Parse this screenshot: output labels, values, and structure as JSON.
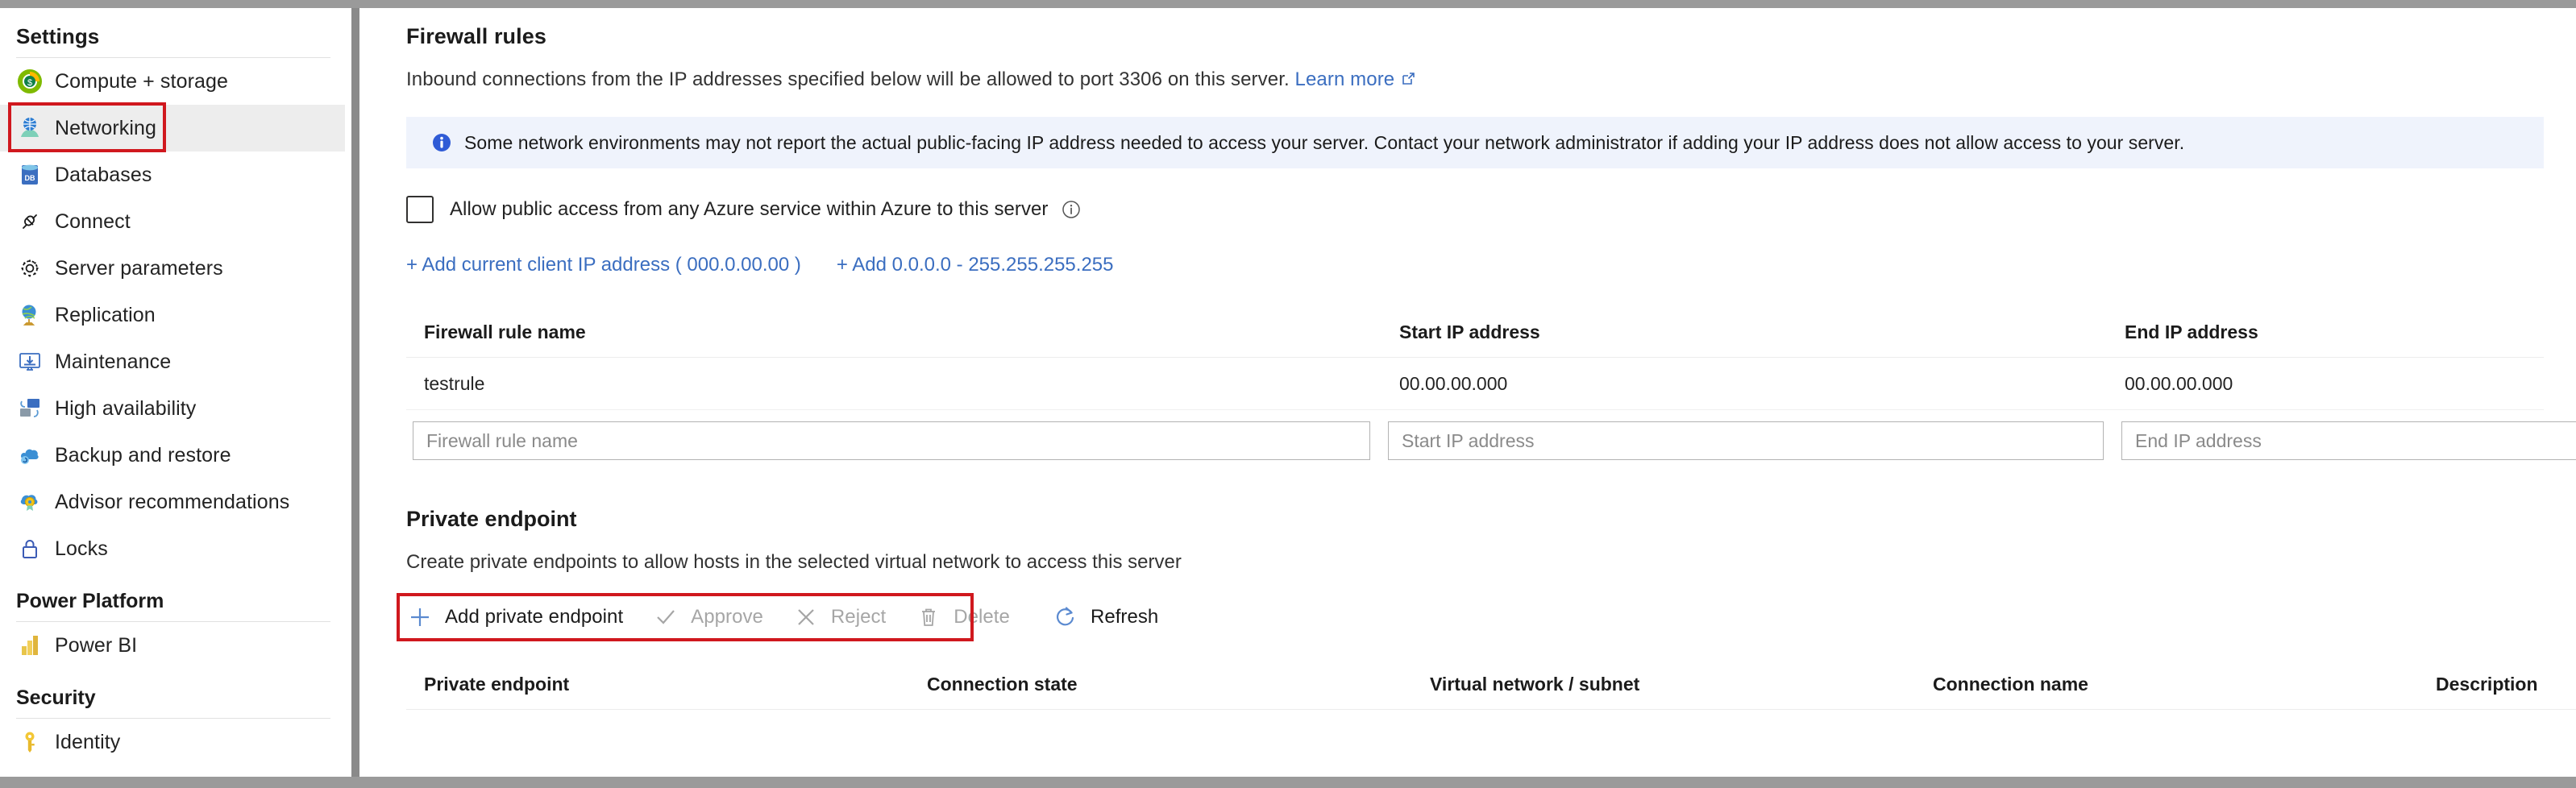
{
  "sidebar": {
    "heading": "Settings",
    "items": [
      {
        "label": "Compute + storage",
        "icon": "compute-storage-icon",
        "selected": false
      },
      {
        "label": "Networking",
        "icon": "networking-icon",
        "selected": true
      },
      {
        "label": "Databases",
        "icon": "databases-icon",
        "selected": false
      },
      {
        "label": "Connect",
        "icon": "connect-icon",
        "selected": false
      },
      {
        "label": "Server parameters",
        "icon": "gear-icon",
        "selected": false
      },
      {
        "label": "Replication",
        "icon": "replication-globe-icon",
        "selected": false
      },
      {
        "label": "Maintenance",
        "icon": "maintenance-icon",
        "selected": false
      },
      {
        "label": "High availability",
        "icon": "high-availability-icon",
        "selected": false
      },
      {
        "label": "Backup and restore",
        "icon": "backup-restore-icon",
        "selected": false
      },
      {
        "label": "Advisor recommendations",
        "icon": "advisor-icon",
        "selected": false
      },
      {
        "label": "Locks",
        "icon": "lock-icon",
        "selected": false
      }
    ],
    "group_power_platform": "Power Platform",
    "power_items": [
      {
        "label": "Power BI",
        "icon": "power-bi-icon"
      }
    ],
    "group_security": "Security",
    "security_items": [
      {
        "label": "Identity",
        "icon": "key-icon"
      }
    ]
  },
  "firewall": {
    "title": "Firewall rules",
    "description_prefix": "Inbound connections from the IP addresses specified below will be allowed to port 3306 on this server.",
    "learn_more": "Learn more",
    "info_banner": "Some network environments may not report the actual public-facing IP address needed to access your server.  Contact your network administrator if adding your IP address does not allow access to your server.",
    "allow_public_access_label": "Allow public access from any Azure service within Azure to this server",
    "allow_public_access_checked": false,
    "add_current_ip_link": "+ Add current client IP address ( 000.0.00.00 )",
    "add_all_ip_link": "+ Add 0.0.0.0 - 255.255.255.255",
    "columns": [
      "Firewall rule name",
      "Start IP address",
      "End IP address"
    ],
    "rows": [
      {
        "name": "testrule",
        "start_ip": "00.00.00.000",
        "end_ip": "00.00.00.000"
      }
    ],
    "new_row_placeholders": {
      "name": "Firewall rule name",
      "start_ip": "Start IP address",
      "end_ip": "End IP address"
    },
    "new_row_values": {
      "name": "",
      "start_ip": "",
      "end_ip": ""
    }
  },
  "private_endpoint": {
    "title": "Private endpoint",
    "description": "Create private endpoints to allow hosts in the selected virtual network to access this server",
    "commands": [
      {
        "label": "Add private endpoint",
        "icon": "plus-icon",
        "disabled": false
      },
      {
        "label": "Approve",
        "icon": "check-icon",
        "disabled": true
      },
      {
        "label": "Reject",
        "icon": "x-icon",
        "disabled": true
      },
      {
        "label": "Delete",
        "icon": "trash-icon",
        "disabled": true
      },
      {
        "label": "Refresh",
        "icon": "refresh-icon",
        "disabled": false
      }
    ],
    "columns": [
      "Private endpoint",
      "Connection state",
      "Virtual network / subnet",
      "Connection name",
      "Description"
    ],
    "rows": []
  },
  "colors": {
    "highlight_outline": "#d0181e",
    "link": "#3b6ec0",
    "info_banner_bg": "#eff3fc",
    "selected_row_bg": "#ededed",
    "chrome_gray": "#9a9a9a"
  }
}
